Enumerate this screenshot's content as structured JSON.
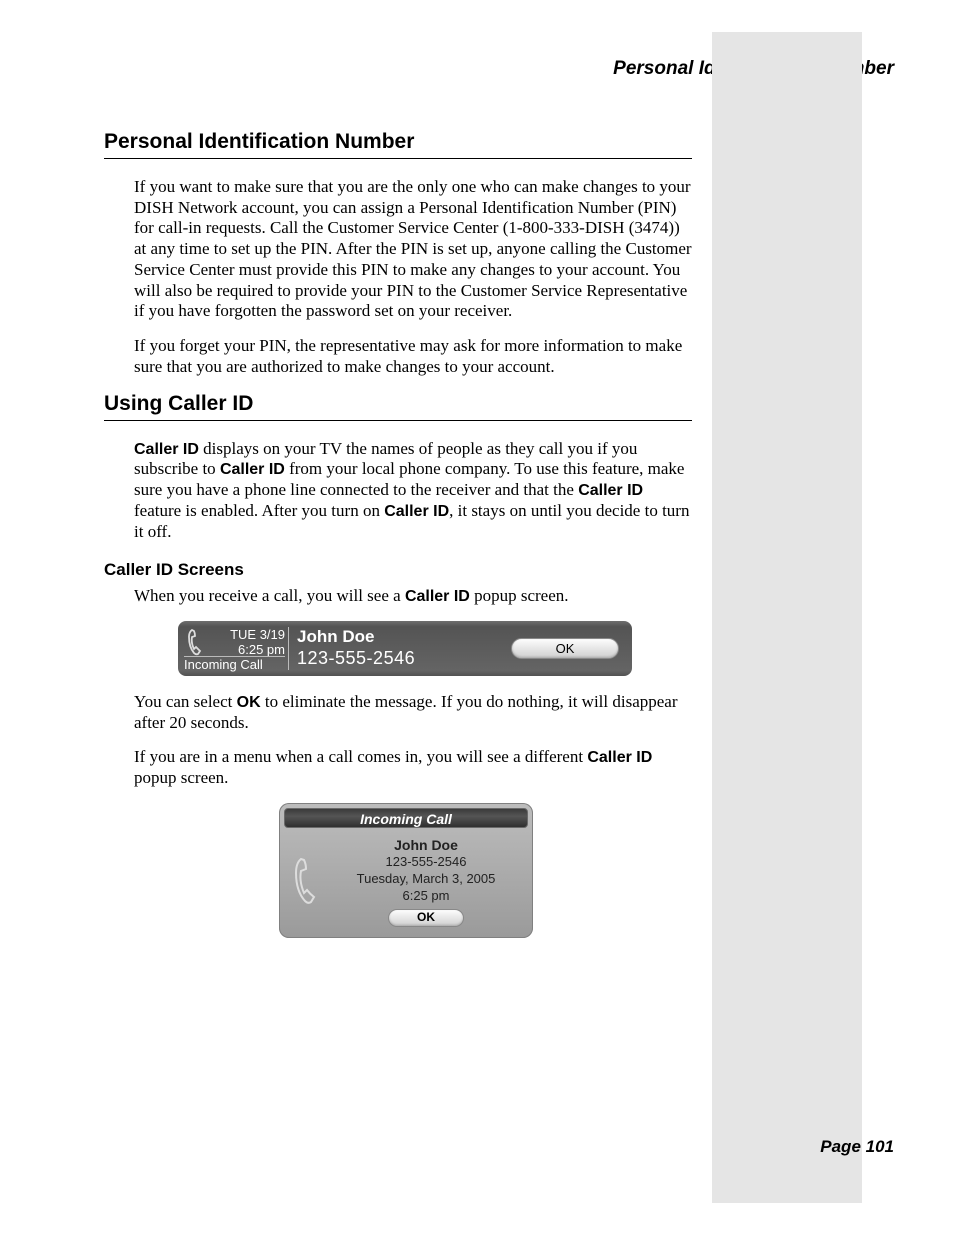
{
  "running_head": "Personal Identification Number",
  "sections": {
    "pin": {
      "heading": "Personal Identification Number",
      "p1": "If you want to make sure that you are the only one who can make changes to your DISH Network account, you can assign a Personal Identification Number (PIN) for call-in requests. Call the Customer Service Center (1-800-333-DISH (3474)) at any time to set up the PIN. After the PIN is set up, anyone calling the Customer Service Center must provide this PIN to make any changes to your account. You will also be required to provide your PIN to the Customer Service Representative if you have forgotten the password set on your receiver.",
      "p2": "If you forget your PIN, the representative may ask for more information to make sure that you are authorized to make changes to your account."
    },
    "cid": {
      "heading": "Using Caller ID",
      "intro_pre": "Caller ID",
      "intro_1": " displays on your TV the names of people as they call you if you subscribe to ",
      "intro_b2": "Caller ID",
      "intro_2": " from your local phone company. To use this feature, make sure you have a phone line connected to the receiver and that the ",
      "intro_b3": "Caller ID",
      "intro_3": " feature is enabled. After you turn on ",
      "intro_b4": "Caller ID",
      "intro_4": ", it stays on until you decide to turn it off.",
      "screens_heading": "Caller ID Screens",
      "screens_p1_a": "When you receive a call, you will see a ",
      "screens_p1_b": "Caller ID",
      "screens_p1_c": " popup screen.",
      "screens_p2_a": "You can select ",
      "screens_p2_b": "OK",
      "screens_p2_c": " to eliminate the message. If you do nothing, it will disappear after 20 seconds.",
      "screens_p3_a": "If you are in a menu when a call comes in, you will see a different ",
      "screens_p3_b": "Caller ID",
      "screens_p3_c": " popup screen."
    }
  },
  "popup_bar": {
    "date": "TUE 3/19",
    "time": "6:25 pm",
    "incoming": "Incoming Call",
    "caller_name": "John Doe",
    "caller_number": "123-555-2546",
    "ok": "OK"
  },
  "popup_card": {
    "title": "Incoming Call",
    "caller_name": "John Doe",
    "caller_number": "123-555-2546",
    "date": "Tuesday, March 3, 2005",
    "time": "6:25 pm",
    "ok": "OK"
  },
  "footer": "Page 101"
}
